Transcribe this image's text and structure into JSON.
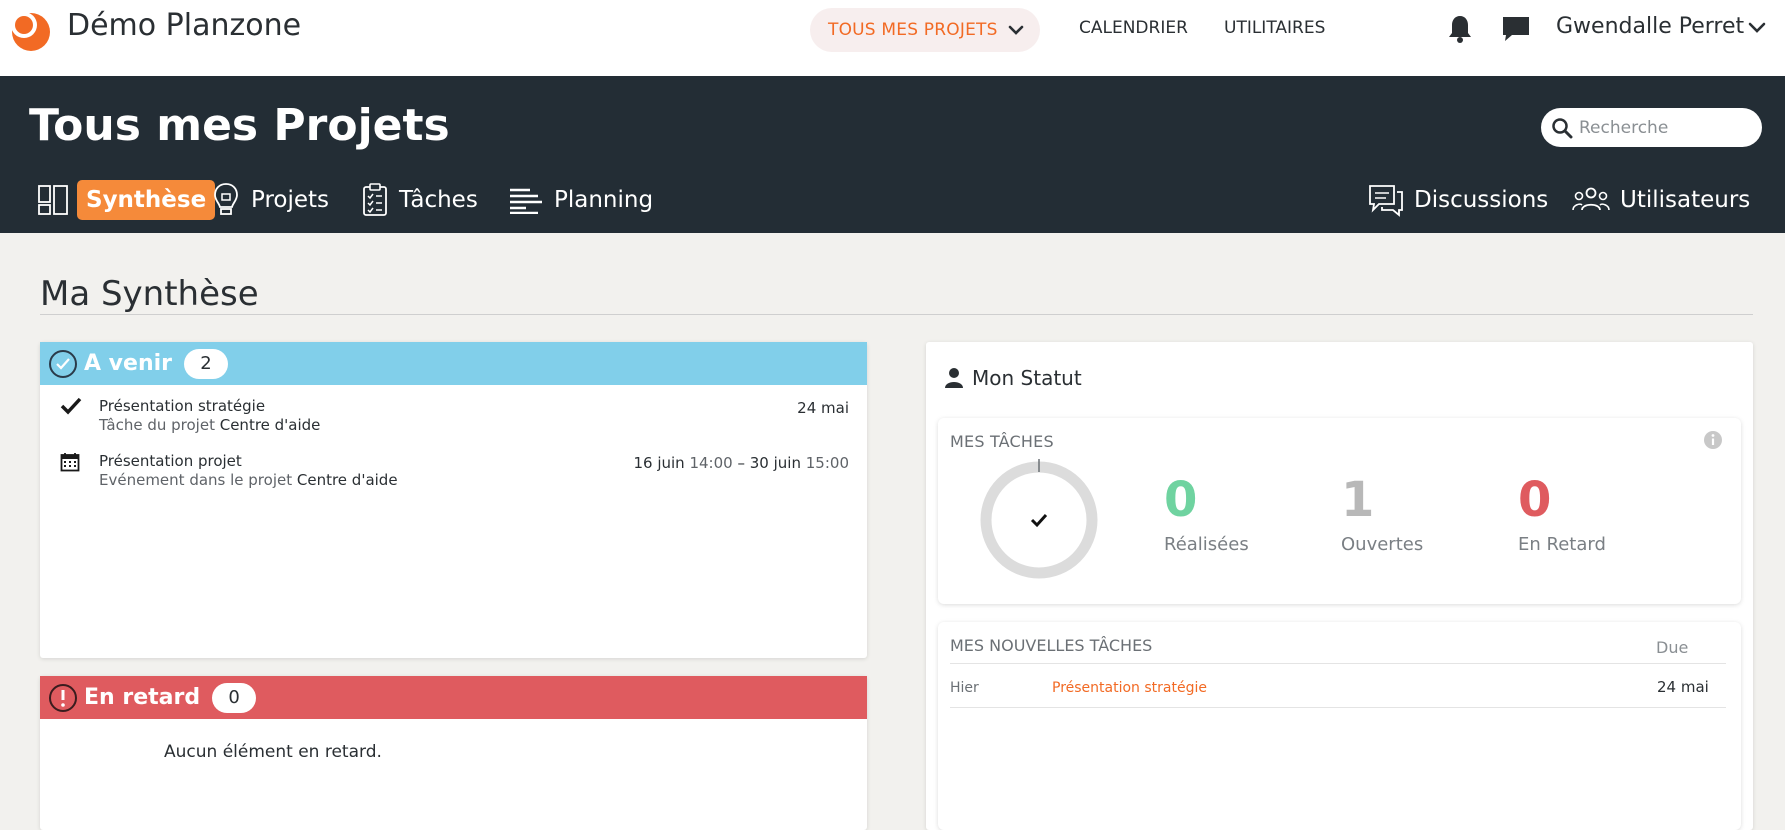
{
  "app": {
    "title": "Démo Planzone"
  },
  "topnav": {
    "projects_label": "TOUS MES PROJETS",
    "calendar_label": "CALENDRIER",
    "utilities_label": "UTILITAIRES",
    "user_name": "Gwendalle Perret"
  },
  "header": {
    "title": "Tous mes Projets",
    "search_placeholder": "Recherche",
    "tabs": [
      {
        "label": "Synthèse",
        "icon": "dashboard-icon",
        "active": true
      },
      {
        "label": "Projets",
        "icon": "lightbulb-icon",
        "active": false
      },
      {
        "label": "Tâches",
        "icon": "clipboard-icon",
        "active": false
      },
      {
        "label": "Planning",
        "icon": "gantt-icon",
        "active": false
      },
      {
        "label": "Discussions",
        "icon": "discussion-icon",
        "active": false
      },
      {
        "label": "Utilisateurs",
        "icon": "users-icon",
        "active": false
      }
    ]
  },
  "main": {
    "title": "Ma Synthèse",
    "upcoming": {
      "title": "A venir",
      "count": "2",
      "color": "#81cfea",
      "items": [
        {
          "icon": "check-icon",
          "title": "Présentation stratégie",
          "subtitle_prefix": "Tâche du projet ",
          "project": "Centre d'aide",
          "date_start": "24 mai"
        },
        {
          "icon": "calendar-icon",
          "title": "Présentation projet",
          "subtitle_prefix": "Evénement dans le projet ",
          "project": "Centre d'aide",
          "date_start": "16 juin",
          "time_start": "14:00",
          "separator": "–",
          "date_end": "30 juin",
          "time_end": "15:00"
        }
      ]
    },
    "late": {
      "title": "En retard",
      "count": "0",
      "color": "#df5b5f",
      "empty_message": "Aucun élément en retard."
    },
    "status": {
      "title": "Mon Statut",
      "tasks_label": "MES TÂCHES",
      "done_value": "0",
      "done_label": "Réalisées",
      "open_value": "1",
      "open_label": "Ouvertes",
      "late_value": "0",
      "late_label": "En Retard",
      "colors": {
        "done": "#6fd3a0",
        "open": "#b8b8b8",
        "late": "#df5b5f"
      },
      "completion_fraction": 0
    },
    "new_tasks": {
      "label": "MES NOUVELLES TÂCHES",
      "due_label": "Due",
      "rows": [
        {
          "when": "Hier",
          "task": "Présentation stratégie",
          "due": "24 mai"
        }
      ]
    }
  },
  "colors": {
    "accent": "#f26a24",
    "header_bg": "#232d35",
    "active_tab": "#f58a3a"
  }
}
